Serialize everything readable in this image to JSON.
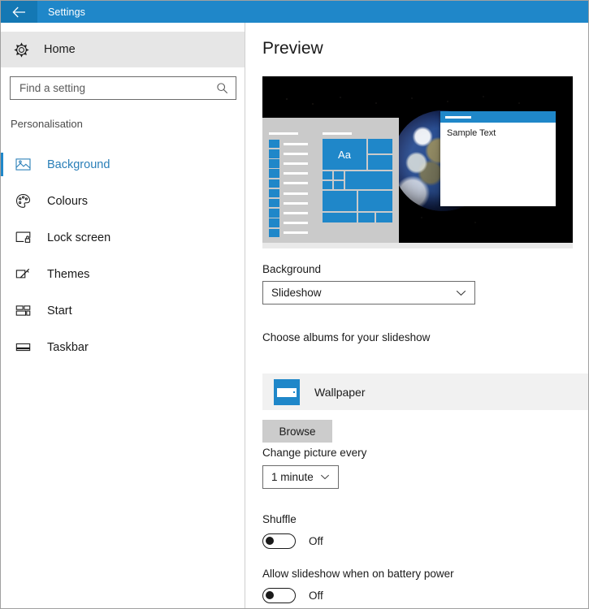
{
  "titlebar": {
    "back_icon": "back-arrow-icon",
    "title": "Settings"
  },
  "sidebar": {
    "home": {
      "label": "Home",
      "icon": "gear-icon"
    },
    "search": {
      "placeholder": "Find a setting",
      "value": "",
      "icon": "search-icon"
    },
    "group_label": "Personalisation",
    "items": [
      {
        "label": "Background",
        "icon": "picture-icon",
        "selected": true
      },
      {
        "label": "Colours",
        "icon": "palette-icon",
        "selected": false
      },
      {
        "label": "Lock screen",
        "icon": "lock-screen-icon",
        "selected": false
      },
      {
        "label": "Themes",
        "icon": "themes-brush-icon",
        "selected": false
      },
      {
        "label": "Start",
        "icon": "start-tiles-icon",
        "selected": false
      },
      {
        "label": "Taskbar",
        "icon": "taskbar-icon",
        "selected": false
      }
    ]
  },
  "main": {
    "page_title": "Preview",
    "preview": {
      "sample_window_text": "Sample Text",
      "start_tile_text": "Aa"
    },
    "background": {
      "label": "Background",
      "value": "Slideshow"
    },
    "albums": {
      "label": "Choose albums for your slideshow",
      "items": [
        {
          "name": "Wallpaper",
          "icon": "folder-picture-icon"
        }
      ],
      "browse_label": "Browse"
    },
    "interval": {
      "label": "Change picture every",
      "value": "1 minute"
    },
    "shuffle": {
      "label": "Shuffle",
      "state": "Off",
      "on": false
    },
    "battery": {
      "label": "Allow slideshow when on battery power",
      "state": "Off",
      "on": false
    }
  },
  "colors": {
    "accent": "#1f87c9",
    "titlebar": "#1f87c9",
    "back_button": "#1478b4",
    "selected_text": "#2a7fb8",
    "home_row_bg": "#e6e6e6",
    "album_row_bg": "#f1f1f1",
    "browse_bg": "#cccccc"
  }
}
